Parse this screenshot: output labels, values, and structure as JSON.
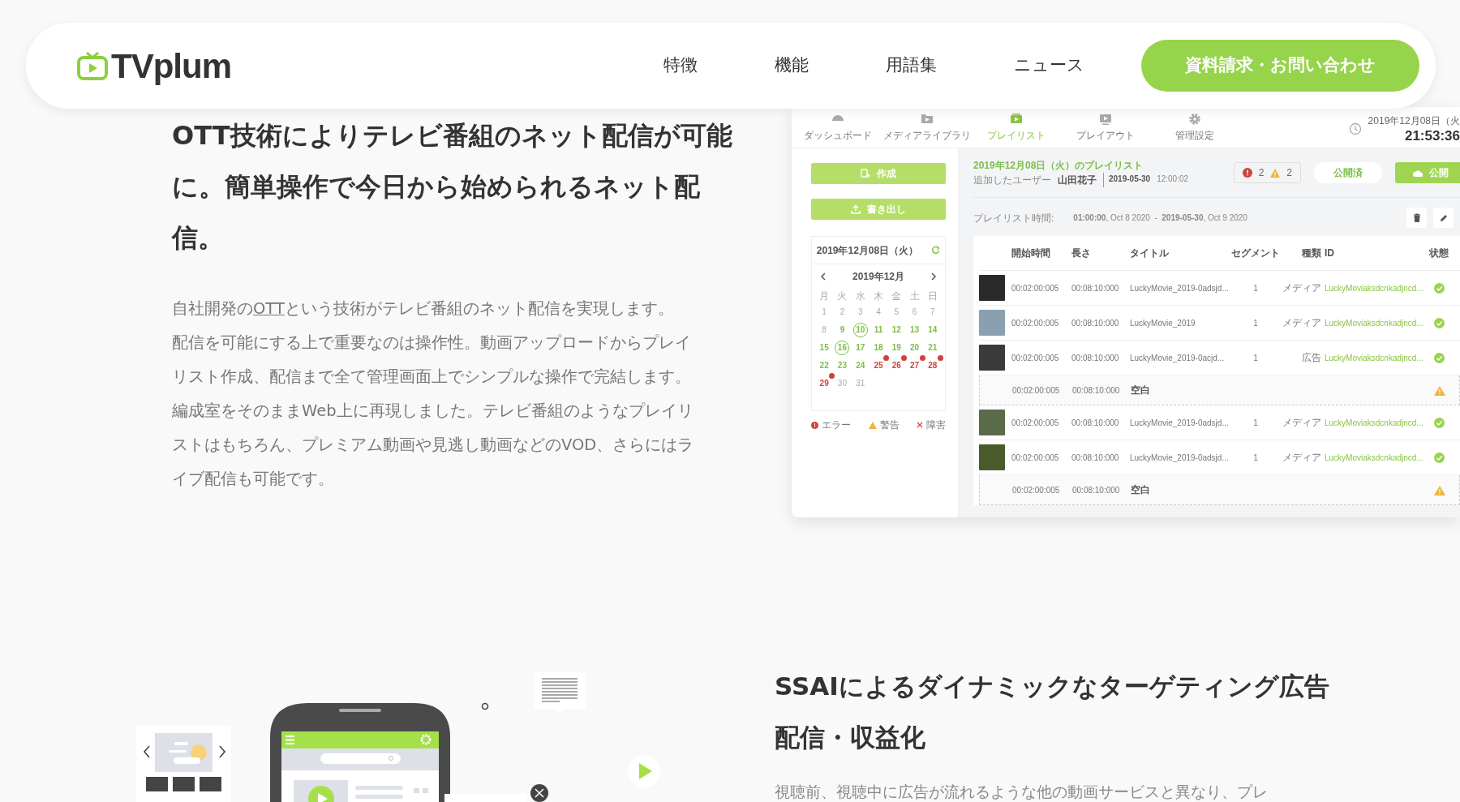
{
  "header": {
    "logo": "TVplum",
    "nav": [
      "特徴",
      "機能",
      "用語集",
      "ニュース"
    ],
    "cta": "資料請求・お問い合わせ"
  },
  "intro": {
    "heading": "OTT技術によりテレビ番組のネット配信が可能に。簡単操作で今日から始められるネット配信。",
    "lead": "自社開発の",
    "link": "OTT",
    "lead_rest": "という技術がテレビ番組のネット配信を実現します。",
    "paragraph": "配信を可能にする上で重要なのは操作性。動画アップロードからプレイリスト作成、配信まで全て管理画面上でシンプルな操作で完結します。編成室をそのままWeb上に再現しました。テレビ番組のようなプレイリストはもちろん、プレミアム動画や見逃し動画などのVOD、さらにはライブ配信も可能です。"
  },
  "app": {
    "tabs": [
      {
        "label": "ダッシュボード",
        "selected": false
      },
      {
        "label": "メディアライブラリ",
        "selected": false
      },
      {
        "label": "プレイリスト",
        "selected": true
      },
      {
        "label": "プレイアウト",
        "selected": false
      },
      {
        "label": "管理設定",
        "selected": false
      }
    ],
    "clock": {
      "date": "2019年12月08日（火",
      "time": "21:53:36"
    },
    "sidebar": {
      "buttons": [
        "作成",
        "書き出し"
      ],
      "calendar": {
        "date": "2019年12月08日（火）",
        "month": "2019年12月",
        "weekdays": [
          "月",
          "火",
          "水",
          "木",
          "金",
          "土",
          "日"
        ],
        "days": [
          {
            "d": "1",
            "kind": "muted"
          },
          {
            "d": "2",
            "kind": "muted"
          },
          {
            "d": "3",
            "kind": "muted"
          },
          {
            "d": "4",
            "kind": "muted"
          },
          {
            "d": "5",
            "kind": "muted"
          },
          {
            "d": "6",
            "kind": "muted"
          },
          {
            "d": "7",
            "kind": "muted"
          },
          {
            "d": "8",
            "kind": "muted"
          },
          {
            "d": "9",
            "kind": "ok"
          },
          {
            "d": "10",
            "kind": "marked"
          },
          {
            "d": "11",
            "kind": "ok"
          },
          {
            "d": "12",
            "kind": "ok"
          },
          {
            "d": "13",
            "kind": "ok"
          },
          {
            "d": "14",
            "kind": "ok"
          },
          {
            "d": "15",
            "kind": "ok"
          },
          {
            "d": "16",
            "kind": "marked"
          },
          {
            "d": "17",
            "kind": "ok"
          },
          {
            "d": "18",
            "kind": "ok"
          },
          {
            "d": "19",
            "kind": "ok"
          },
          {
            "d": "20",
            "kind": "ok"
          },
          {
            "d": "21",
            "kind": "ok"
          },
          {
            "d": "22",
            "kind": "ok"
          },
          {
            "d": "23",
            "kind": "ok"
          },
          {
            "d": "24",
            "kind": "ok"
          },
          {
            "d": "25",
            "kind": "error"
          },
          {
            "d": "26",
            "kind": "error"
          },
          {
            "d": "27",
            "kind": "error"
          },
          {
            "d": "28",
            "kind": "error"
          },
          {
            "d": "29",
            "kind": "error"
          },
          {
            "d": "30",
            "kind": "muted"
          },
          {
            "d": "31",
            "kind": "muted"
          }
        ]
      },
      "legend": [
        {
          "label": "エラー",
          "kind": "error"
        },
        {
          "label": "警告",
          "kind": "warning"
        },
        {
          "label": "障害",
          "kind": "failure"
        }
      ]
    },
    "playlist": {
      "title": "2019年12月08日（火）のプレイリスト",
      "added_by": "追加したユーザー",
      "user": "山田花子",
      "date": "2019-05-30",
      "time": "12:00:02",
      "error_count": "2",
      "warning_count": "2",
      "status_button": "公開済",
      "publish_button": "公開",
      "period_label": "プレイリスト時間:",
      "period": "**01:00:00**, Oct 8 2020  -  **2019-05-30**, Oct 9 2020"
    },
    "table": {
      "columns": [
        "開始時間",
        "長さ",
        "タイトル",
        "セグメント",
        "種類",
        "ID",
        "状態"
      ],
      "rows": [
        {
          "kind": "media",
          "start": "00:02:00:005",
          "length": "00:08:10:000",
          "title": "LuckyMovie_2019-0adsjd...",
          "segment": "1",
          "type": "メディア",
          "id": "LuckyMoviaksdcnkadjncd...",
          "warning": false
        },
        {
          "kind": "media",
          "start": "00:02:00:005",
          "length": "00:08:10:000",
          "title": "LuckyMovie_2019",
          "segment": "1",
          "type": "メディア",
          "id": "LuckyMoviaksdcnkadjncd...",
          "warning": false
        },
        {
          "kind": "media",
          "start": "00:02:00:005",
          "length": "00:08:10:000",
          "title": "LuckyMovie_2019-0acjd...",
          "segment": "1",
          "type": "広告",
          "id": "LuckyMoviaksdcnkadjncd...",
          "warning": false
        },
        {
          "kind": "blank",
          "start": "00:02:00:005",
          "length": "00:08:10:000",
          "title": "空白",
          "warning": true
        },
        {
          "kind": "media",
          "start": "00:02:00:005",
          "length": "00:08:10:000",
          "title": "LuckyMovie_2019-0adsjd...",
          "segment": "1",
          "type": "メディア",
          "id": "LuckyMoviaksdcnkadjncd...",
          "warning": false
        },
        {
          "kind": "media",
          "start": "00:02:00:005",
          "length": "00:08:10:000",
          "title": "LuckyMovie_2019-0adsjd...",
          "segment": "1",
          "type": "メディア",
          "id": "LuckyMoviaksdcnkadjncd...",
          "warning": false
        },
        {
          "kind": "blank",
          "start": "00:02:00:005",
          "length": "00:08:10:000",
          "title": "空白",
          "warning": true
        }
      ]
    }
  },
  "section2": {
    "heading": "SSAIによるダイナミックなターゲティング広告配信・収益化",
    "paragraph": "視聴前、視聴中に広告が流れるような他の動画サービスと異なり、プレ"
  }
}
